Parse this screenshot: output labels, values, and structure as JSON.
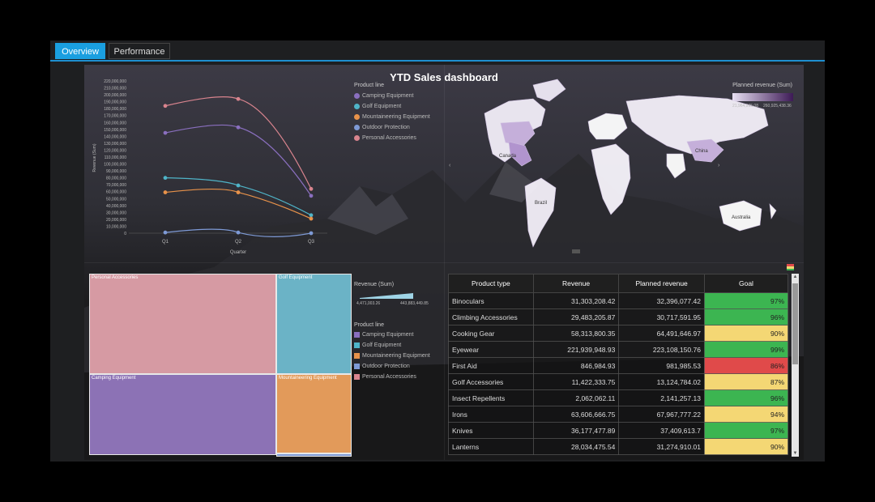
{
  "tabs": [
    {
      "label": "Overview",
      "active": true
    },
    {
      "label": "Performance",
      "active": false
    }
  ],
  "dashboard_title": "YTD Sales dashboard",
  "line_chart": {
    "legend_title": "Product line",
    "legend": [
      {
        "label": "Camping Equipment",
        "color": "#8a6fbf"
      },
      {
        "label": "Golf Equipment",
        "color": "#4fb4c8"
      },
      {
        "label": "Mountaineering Equipment",
        "color": "#e8924a"
      },
      {
        "label": "Outdoor Protection",
        "color": "#7e9ad6"
      },
      {
        "label": "Personal Accessories",
        "color": "#d9848e"
      }
    ]
  },
  "map": {
    "legend_title": "Planned revenue (Sum)",
    "min_label": "21,964,995.08",
    "max_label": "260,925,438.36",
    "labels": {
      "canada": "Canada",
      "brazil": "Brazil",
      "china": "China",
      "australia": "Australia"
    }
  },
  "treemap": {
    "legend_title_size": "Revenue (Sum)",
    "size_min_label": "4,471,003.26",
    "size_max_label": "443,883,449.85",
    "legend_title": "Product line",
    "legend": [
      {
        "label": "Camping Equipment",
        "color": "#8a6fbf"
      },
      {
        "label": "Golf Equipment",
        "color": "#4fb4c8"
      },
      {
        "label": "Mountaineering Equipment",
        "color": "#e8924a"
      },
      {
        "label": "Outdoor Protection",
        "color": "#7e9ad6"
      },
      {
        "label": "Personal Accessories",
        "color": "#d9848e"
      }
    ],
    "cells": {
      "personal": "Personal Accessories",
      "golf": "Golf Equipment",
      "camping": "Camping Equipment",
      "mountaineering": "Mountaineering Equipment"
    }
  },
  "table": {
    "headers": [
      "Product type",
      "Revenue",
      "Planned revenue",
      "Goal"
    ],
    "rows": [
      {
        "type": "Binoculars",
        "revenue": "31,303,208.42",
        "planned": "32,396,077.42",
        "goal": "97%",
        "status": "green"
      },
      {
        "type": "Climbing Accessories",
        "revenue": "29,483,205.87",
        "planned": "30,717,591.95",
        "goal": "96%",
        "status": "green"
      },
      {
        "type": "Cooking Gear",
        "revenue": "58,313,800.35",
        "planned": "64,491,646.97",
        "goal": "90%",
        "status": "yellow"
      },
      {
        "type": "Eyewear",
        "revenue": "221,939,948.93",
        "planned": "223,108,150.76",
        "goal": "99%",
        "status": "green"
      },
      {
        "type": "First Aid",
        "revenue": "846,984.93",
        "planned": "981,985.53",
        "goal": "86%",
        "status": "red"
      },
      {
        "type": "Golf Accessories",
        "revenue": "11,422,333.75",
        "planned": "13,124,784.02",
        "goal": "87%",
        "status": "yellow"
      },
      {
        "type": "Insect Repellents",
        "revenue": "2,062,062.11",
        "planned": "2,141,257.13",
        "goal": "96%",
        "status": "green"
      },
      {
        "type": "Irons",
        "revenue": "63,606,666.75",
        "planned": "67,967,777.22",
        "goal": "94%",
        "status": "yellow"
      },
      {
        "type": "Knives",
        "revenue": "36,177,477.89",
        "planned": "37,409,613.7",
        "goal": "97%",
        "status": "green"
      },
      {
        "type": "Lanterns",
        "revenue": "28,034,475.54",
        "planned": "31,274,910.01",
        "goal": "90%",
        "status": "yellow"
      }
    ]
  },
  "status_colors": {
    "green": "#3cb551",
    "yellow": "#f4d774",
    "red": "#e04a4a"
  },
  "chart_data": {
    "type": "line",
    "categories": [
      "Q1",
      "Q2",
      "Q3"
    ],
    "xlabel": "Quarter",
    "ylabel": "Revenue (Sum)",
    "ylim": [
      0,
      220000000
    ],
    "yticks": [
      "0",
      "10,000,000",
      "20,000,000",
      "30,000,000",
      "40,000,000",
      "50,000,000",
      "60,000,000",
      "70,000,000",
      "80,000,000",
      "90,000,000",
      "100,000,000",
      "110,000,000",
      "120,000,000",
      "130,000,000",
      "140,000,000",
      "150,000,000",
      "160,000,000",
      "170,000,000",
      "180,000,000",
      "190,000,000",
      "200,000,000",
      "210,000,000",
      "220,000,000"
    ],
    "series": [
      {
        "name": "Camping Equipment",
        "color": "#8a6fbf",
        "values": [
          145000000,
          153000000,
          54000000
        ]
      },
      {
        "name": "Golf Equipment",
        "color": "#4fb4c8",
        "values": [
          80000000,
          69000000,
          26000000
        ]
      },
      {
        "name": "Mountaineering Equipment",
        "color": "#e8924a",
        "values": [
          59000000,
          59000000,
          21000000
        ]
      },
      {
        "name": "Outdoor Protection",
        "color": "#7e9ad6",
        "values": [
          1000000,
          1000000,
          0
        ]
      },
      {
        "name": "Personal Accessories",
        "color": "#d9848e",
        "values": [
          184000000,
          194000000,
          64000000
        ]
      }
    ]
  }
}
